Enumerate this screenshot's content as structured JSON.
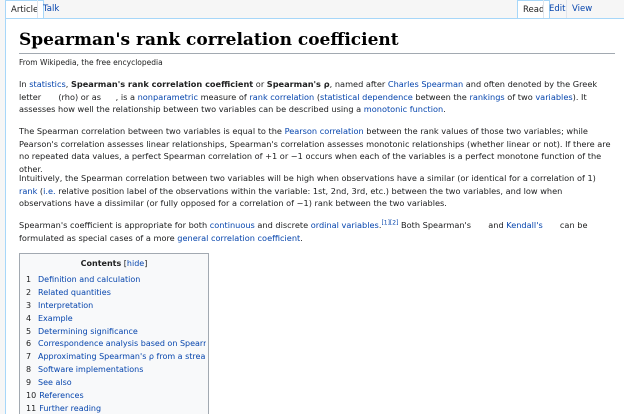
{
  "tabs": {
    "article": "Article",
    "talk": "Talk",
    "read": "Read",
    "edit": "Edit",
    "history": "View history"
  },
  "page": {
    "title": "Spearman's rank correlation coefficient",
    "tagline": "From Wikipedia, the free encyclopedia"
  },
  "p1": {
    "t1": "In ",
    "l1": "statistics",
    "t2": ", ",
    "b1": "Spearman's rank correlation coefficient",
    "t3": " or ",
    "b2": "Spearman's ρ",
    "t4": ", named after ",
    "l2": "Charles Spearman",
    "t5": " and often denoted by the Greek letter ",
    "t6": " (rho) or as",
    "t7": ", is a ",
    "l3": "nonparametric",
    "t8": " measure of ",
    "l4": "rank correlation",
    "t9": " (",
    "l5": "statistical dependence",
    "t10": " between the ",
    "l6": "rankings",
    "t11": " of two ",
    "l7": "variables",
    "t12": "). It assesses how well the relationship between two variables can be described using a ",
    "l8": "monotonic function",
    "t13": "."
  },
  "p2": {
    "t1": "The Spearman correlation between two variables is equal to the ",
    "l1": "Pearson correlation",
    "t2": " between the rank values of those two variables; while Pearson's correlation assesses linear relationships, Spearman's correlation assesses monotonic relationships (whether linear or not). If there are no repeated data values, a perfect Spearman correlation of +1 or −1 occurs when each of the variables is a perfect monotone function of the other."
  },
  "p3": {
    "t1": "Intuitively, the Spearman correlation between two variables will be high when observations have a similar (or identical for a correlation of 1) ",
    "l1": "rank",
    "t2": " (",
    "l2": "i.e.",
    "t3": " relative position label of the observations within the variable: 1st, 2nd, 3rd, etc.) between the two variables, and low when observations have a dissimilar (or fully opposed for a correlation of −1) rank between the two variables."
  },
  "p4": {
    "t1": "Spearman's coefficient is appropriate for both ",
    "l1": "continuous",
    "t2": " and discrete ",
    "l2": "ordinal variables",
    "r1": "[1][2]",
    "t3": " Both Spearman's ",
    "t4": " and ",
    "l3": "Kendall's",
    "t5": " can be formulated as special cases of a more ",
    "l4": "general correlation coefficient",
    "t6": "."
  },
  "toc": {
    "title": "Contents",
    "hide_open": " [",
    "hide": "hide",
    "hide_close": "]",
    "items": [
      {
        "num": "1",
        "text": "Definition and calculation"
      },
      {
        "num": "2",
        "text": "Related quantities"
      },
      {
        "num": "3",
        "text": "Interpretation"
      },
      {
        "num": "4",
        "text": "Example"
      },
      {
        "num": "5",
        "text": "Determining significance"
      },
      {
        "num": "6",
        "text": "Correspondence analysis based on Spearman's ρ"
      },
      {
        "num": "7",
        "text": "Approximating Spearman's ρ from a stream"
      },
      {
        "num": "8",
        "text": "Software implementations"
      },
      {
        "num": "9",
        "text": "See also"
      },
      {
        "num": "10",
        "text": "References"
      },
      {
        "num": "11",
        "text": "Further reading"
      },
      {
        "num": "12",
        "text": "External links"
      }
    ]
  }
}
